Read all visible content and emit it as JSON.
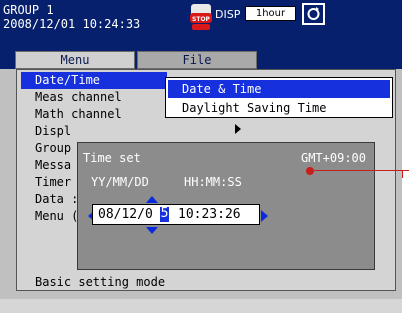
{
  "status_bar": {
    "group": "GROUP 1",
    "datetime": "2008/12/01 10:24:33",
    "stop_icon": "stop-badge-icon",
    "disp_label": "DISP",
    "interval": "1hour",
    "cycle_icon": "recycle-icon"
  },
  "tabs": {
    "menu": "Menu",
    "file": "File"
  },
  "menu": {
    "items": [
      "Date/Time",
      "Meas channel",
      "Math channel",
      "Displ",
      "Group",
      "Messa",
      "Timer",
      "Data :",
      "Menu (",
      "Basic setting mode"
    ],
    "selected_index": 0
  },
  "submenu": {
    "items": [
      "Date & Time",
      "Daylight Saving Time"
    ],
    "selected_index": 0
  },
  "dialog": {
    "title": "Time set",
    "gmt": "GMT+09:00",
    "format_date": "YY/MM/DD",
    "format_time": "HH:MM:SS",
    "value_date_prefix": "08/12/0",
    "value_cursor_digit": "5",
    "value_time": "10:23:26"
  },
  "colors": {
    "title_bar": "#06206e",
    "selection": "#1530dc",
    "arrow_blue": "#0a2ae0",
    "callout": "#c81e1e"
  }
}
